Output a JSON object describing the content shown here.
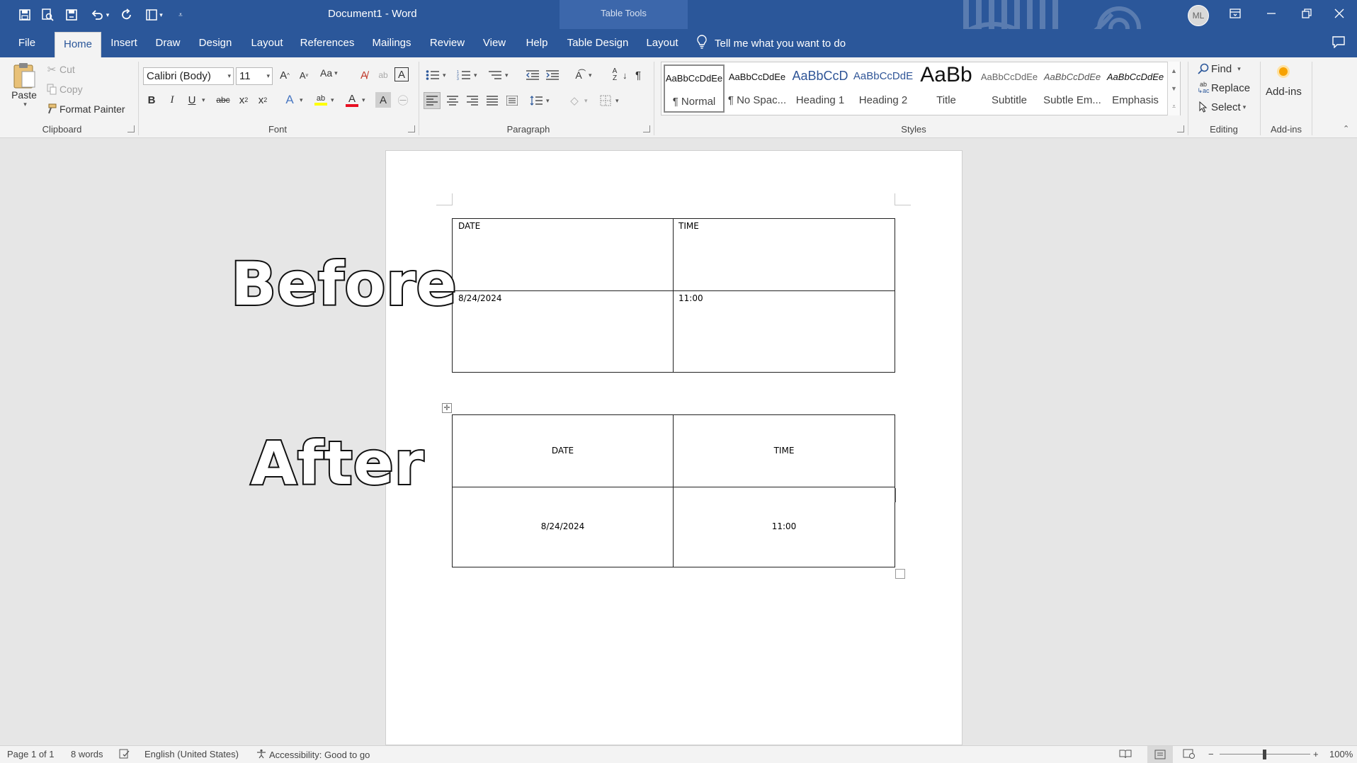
{
  "window": {
    "doc_name": "Document1",
    "separator": " - ",
    "app_name": "Word",
    "context_label": "Table Tools",
    "avatar_initials": "ML"
  },
  "tabs": [
    "File",
    "Home",
    "Insert",
    "Draw",
    "Design",
    "Layout",
    "References",
    "Mailings",
    "Review",
    "View",
    "Help",
    "Table Design",
    "Layout"
  ],
  "tell_me": "Tell me what you want to do",
  "clipboard": {
    "paste": "Paste",
    "cut": "Cut",
    "copy": "Copy",
    "format_painter": "Format Painter",
    "label": "Clipboard"
  },
  "font": {
    "name": "Calibri (Body)",
    "size": "11",
    "case_label": "Aa",
    "label": "Font"
  },
  "paragraph": {
    "label": "Paragraph"
  },
  "styles": {
    "label": "Styles",
    "items": [
      {
        "preview": "AaBbCcDdEe",
        "name": "¶ Normal"
      },
      {
        "preview": "AaBbCcDdEe",
        "name": "¶ No Spac..."
      },
      {
        "preview": "AaBbCcD",
        "name": "Heading 1"
      },
      {
        "preview": "AaBbCcDdE",
        "name": "Heading 2"
      },
      {
        "preview": "AaBb",
        "name": "Title"
      },
      {
        "preview": "AaBbCcDdEe",
        "name": "Subtitle"
      },
      {
        "preview": "AaBbCcDdEe",
        "name": "Subtle Em..."
      },
      {
        "preview": "AaBbCcDdEe",
        "name": "Emphasis"
      }
    ]
  },
  "editing": {
    "find": "Find",
    "replace": "Replace",
    "select": "Select",
    "label": "Editing"
  },
  "addins": {
    "button": "Add-ins",
    "label": "Add-ins"
  },
  "document": {
    "before_label": "Before",
    "after_label": "After",
    "before_table": [
      [
        "DATE",
        "TIME"
      ],
      [
        "8/24/2024",
        "11:00"
      ]
    ],
    "after_table": [
      [
        "DATE",
        "TIME"
      ],
      [
        "8/24/2024",
        "11:00"
      ]
    ]
  },
  "status": {
    "page": "Page 1 of 1",
    "words": "8 words",
    "language": "English (United States)",
    "accessibility": "Accessibility: Good to go",
    "zoom": "100%"
  },
  "colors": {
    "brand": "#2b579a",
    "context_tab": "#3c67ab",
    "ribbon": "#f3f3f3"
  }
}
